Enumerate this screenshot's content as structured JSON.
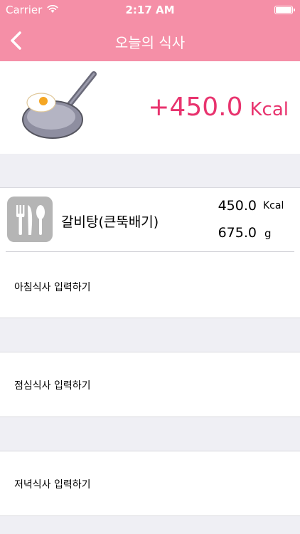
{
  "status_bar": {
    "carrier": "Carrier",
    "time": "2:17 AM"
  },
  "nav": {
    "title": "오늘의 식사"
  },
  "summary": {
    "total_value": "+450.0",
    "total_unit": "Kcal"
  },
  "meals": {
    "breakfast": {
      "add_label": "아침식사 입력하기",
      "items": [
        {
          "name": "갈비탕(큰뚝배기)",
          "kcal": "450.0",
          "kcal_unit": "Kcal",
          "gram": "675.0",
          "gram_unit": "g"
        }
      ]
    },
    "lunch": {
      "add_label": "점심식사 입력하기"
    },
    "dinner": {
      "add_label": "저녁식사 입력하기"
    }
  },
  "colors": {
    "accent": "#f58fa7",
    "total_text": "#e8336e",
    "background": "#efeff4"
  }
}
